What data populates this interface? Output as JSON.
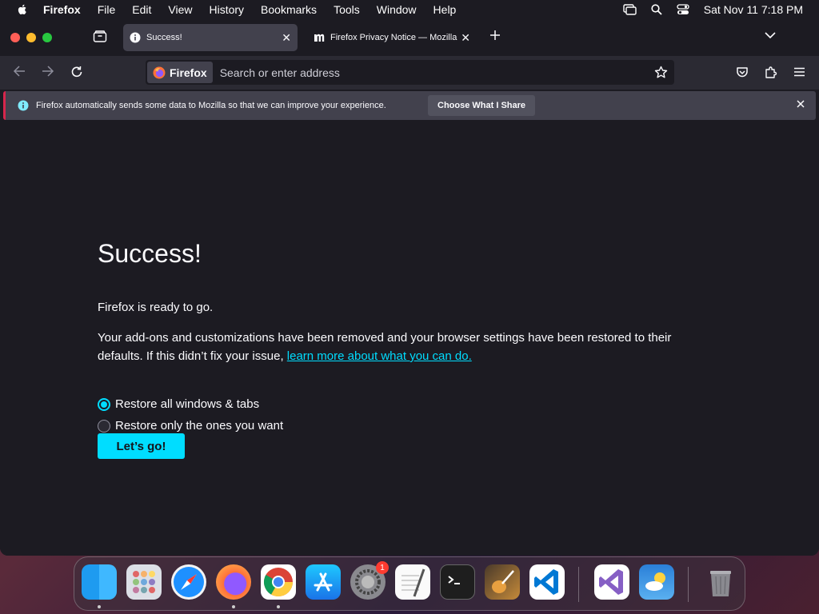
{
  "menubar": {
    "app_name": "Firefox",
    "items": [
      "File",
      "Edit",
      "View",
      "History",
      "Bookmarks",
      "Tools",
      "Window",
      "Help"
    ],
    "clock": "Sat Nov 11  7:18 PM"
  },
  "tabs": [
    {
      "title": "Success!",
      "icon": "info-icon",
      "active": true
    },
    {
      "title": "Firefox Privacy Notice — Mozilla",
      "icon": "mozilla-m-icon",
      "active": false
    }
  ],
  "urlbar": {
    "identity_label": "Firefox",
    "placeholder": "Search or enter address"
  },
  "notification": {
    "message": "Firefox automatically sends some data to Mozilla so that we can improve your experience.",
    "button_label": "Choose What I Share"
  },
  "page": {
    "title": "Success!",
    "ready_text": "Firefox is ready to go.",
    "description": "Your add-ons and customizations have been removed and your browser settings have been restored to their defaults. If this didn’t fix your issue, ",
    "link_text": "learn more about what you can do.",
    "options": [
      {
        "label": "Restore all windows & tabs",
        "selected": true
      },
      {
        "label": "Restore only the ones you want",
        "selected": false
      }
    ],
    "go_button": "Let’s go!"
  },
  "dock": {
    "apps": [
      "Finder",
      "Launchpad",
      "Safari",
      "Firefox",
      "Google Chrome",
      "App Store",
      "System Settings",
      "TextEdit",
      "Terminal",
      "GarageBand",
      "Visual Studio Code",
      "Visual Studio",
      "Weather",
      "Trash"
    ],
    "settings_badge": "1"
  },
  "colors": {
    "accent": "#00ddff",
    "window_bg": "#1c1b22",
    "toolbar_bg": "#2b2a33",
    "notification_bar": "#d7264c"
  }
}
